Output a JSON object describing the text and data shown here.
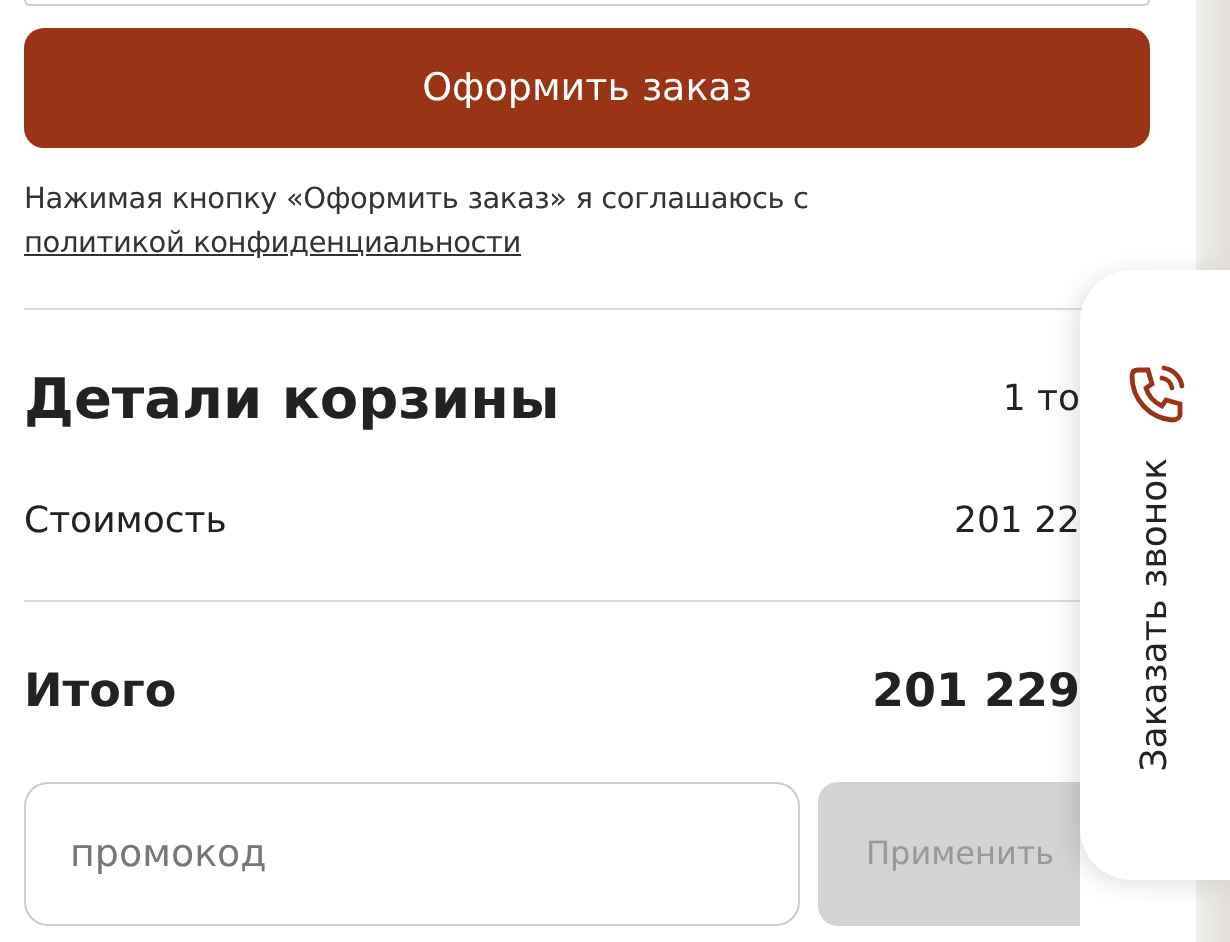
{
  "checkout_button": {
    "label": "Оформить заказ"
  },
  "consent": {
    "text": "Нажимая кнопку «Оформить заказ» я соглашаюсь с ",
    "link": "политикой конфиденциальности"
  },
  "cart_details": {
    "title": "Детали корзины",
    "count": "1 то",
    "rows": [
      {
        "kind": "regular",
        "label": "Стоимость",
        "value": "201 22"
      },
      {
        "kind": "total",
        "label": "Итого",
        "value": "201 229"
      }
    ]
  },
  "promo": {
    "placeholder": "промокод",
    "button": {
      "label": "Применить",
      "disabled": true
    }
  },
  "callback_tab": {
    "label": "Заказать звонок"
  }
}
